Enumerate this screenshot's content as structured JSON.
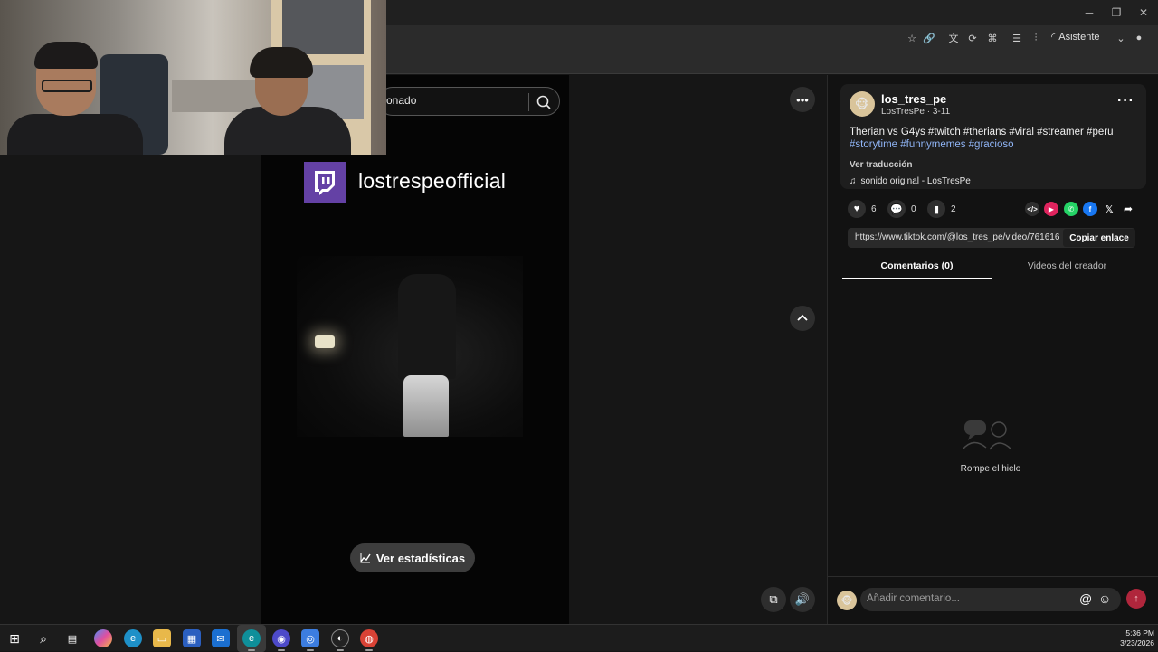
{
  "browser": {
    "assistant_label": "Asistente"
  },
  "search": {
    "text": "onado"
  },
  "video": {
    "channel_name": "lostrespeofficial",
    "stats_button": "Ver estadísticas"
  },
  "post": {
    "username": "los_tres_pe",
    "display_name": "LosTresPe",
    "date": "3-11",
    "caption_plain": "Therian vs G4ys #twitch #therians #viral #streamer #peru",
    "caption_tags": "#storytime #funnymemes #gracioso",
    "translate_label": "Ver traducción",
    "sound": "sonido original - LosTresPe"
  },
  "actions": {
    "likes": "6",
    "comments": "0",
    "saves": "2"
  },
  "link": {
    "url": "https://www.tiktok.com/@los_tres_pe/video/761616...",
    "copy_label": "Copiar enlace"
  },
  "tabs": [
    {
      "label": "Comentarios (0)",
      "active": true
    },
    {
      "label": "Videos del creador",
      "active": false
    }
  ],
  "empty_state": {
    "text": "Rompe el hielo"
  },
  "comment_box": {
    "placeholder": "Añadir comentario..."
  },
  "clock": {
    "time": "5:36 PM",
    "date": "3/23/2026"
  },
  "colors": {
    "twitch": "#6441a5",
    "hashtag": "#8fb4f5",
    "send": "#b0263c"
  }
}
